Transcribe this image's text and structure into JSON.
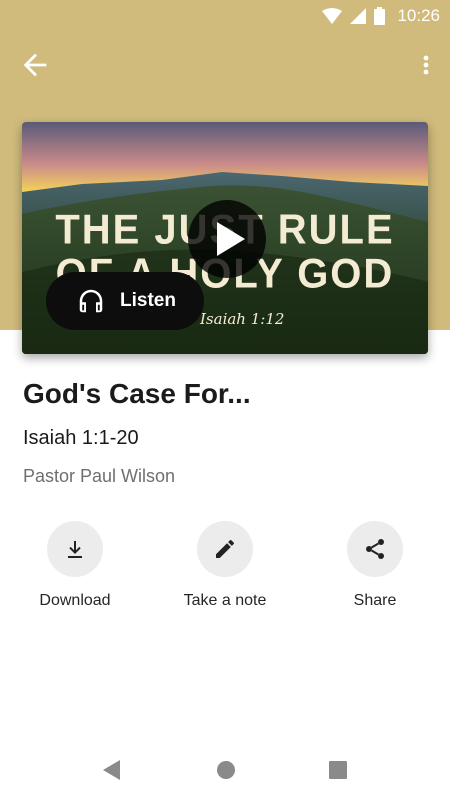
{
  "status_bar": {
    "time": "10:26"
  },
  "app_bar": {
    "back_icon": "arrow-left-icon",
    "more_icon": "more-vertical-icon"
  },
  "artwork": {
    "title_line1": "THE JUST RULE",
    "title_line2": "OF A HOLY GOD",
    "reference": "Isaiah 1:12"
  },
  "listen": {
    "label": "Listen",
    "icon": "headphones-icon"
  },
  "sermon": {
    "title": "God's Case For...",
    "passage": "Isaiah 1:1-20",
    "speaker": "Pastor Paul Wilson"
  },
  "actions": [
    {
      "label": "Download",
      "icon": "download-icon"
    },
    {
      "label": "Take a note",
      "icon": "pencil-icon"
    },
    {
      "label": "Share",
      "icon": "share-icon"
    }
  ],
  "colors": {
    "header": "#d0bb7c",
    "action_circle": "#ececec",
    "listen_bg": "#0d0d0d"
  }
}
